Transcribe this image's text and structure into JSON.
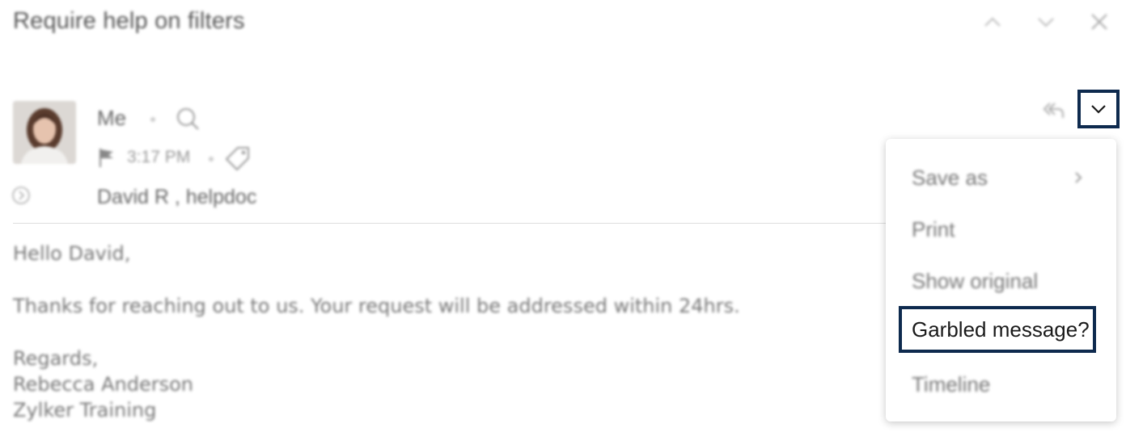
{
  "email": {
    "subject": "Require help on filters",
    "sender": "Me",
    "time": "3:17 PM",
    "recipients": "David R , helpdoc"
  },
  "header_icons": [
    "chevron-up-icon",
    "chevron-down-icon",
    "close-icon"
  ],
  "meta_icons": [
    "search-icon",
    "flag-icon",
    "tag-icon",
    "expand-circle-icon",
    "reply-icon"
  ],
  "body": {
    "greeting": "Hello David,",
    "content": "Thanks for reaching out to us. Your request will be addressed within 24hrs.",
    "signoff": "Regards,",
    "signature_name": "Rebecca Anderson",
    "signature_org": "Zylker Training"
  },
  "more_menu": {
    "items": [
      {
        "label": "Save as",
        "has_submenu": true
      },
      {
        "label": "Print"
      },
      {
        "label": "Show original"
      },
      {
        "label": "Garbled message?",
        "highlighted": true
      },
      {
        "label": "Timeline"
      }
    ]
  },
  "colors": {
    "highlight_border": "#0e2a4e",
    "muted_text": "#777777"
  }
}
